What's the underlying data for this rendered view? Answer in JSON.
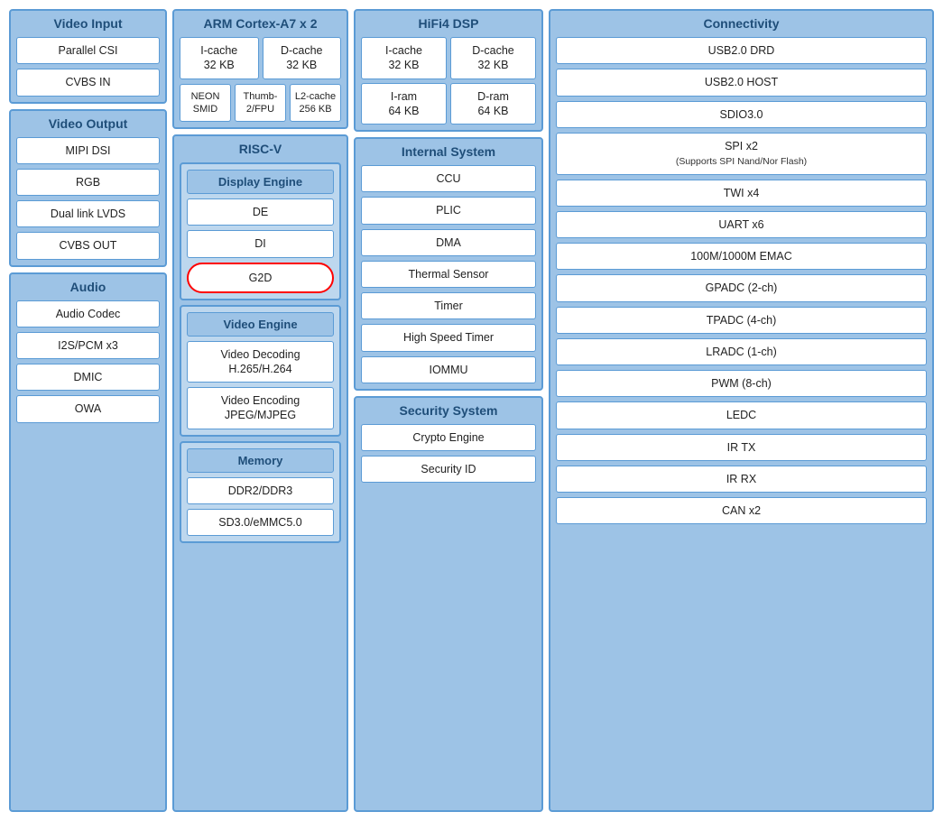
{
  "videoInput": {
    "title": "Video Input",
    "items": [
      "Parallel CSI",
      "CVBS IN"
    ]
  },
  "videoOutput": {
    "title": "Video Output",
    "items": [
      "MIPI DSI",
      "RGB",
      "Dual link LVDS",
      "CVBS OUT"
    ]
  },
  "audio": {
    "title": "Audio",
    "items": [
      "Audio Codec",
      "I2S/PCM x3",
      "DMIC",
      "OWA"
    ]
  },
  "armCortex": {
    "title": "ARM Cortex-A7 x 2",
    "icache": "I-cache\n32 KB",
    "dcache": "D-cache\n32 KB",
    "neon": "NEON\nSMID",
    "thumb": "Thumb-\n2/FPU",
    "l2cache": "L2-cache\n256 KB"
  },
  "riscv": {
    "title": "RISC-V"
  },
  "displayEngine": {
    "title": "Display Engine",
    "items": [
      "DE",
      "DI",
      "G2D"
    ]
  },
  "videoEngine": {
    "title": "Video Engine",
    "items": [
      "Video Decoding\nH.265/H.264",
      "Video Encoding\nJPEG/MJPEG"
    ]
  },
  "memory": {
    "title": "Memory",
    "items": [
      "DDR2/DDR3",
      "SD3.0/eMMC5.0"
    ]
  },
  "hifi4": {
    "title": "HiFi4 DSP",
    "icache": "I-cache\n32 KB",
    "dcache": "D-cache\n32 KB",
    "iram": "I-ram\n64 KB",
    "dram": "D-ram\n64 KB"
  },
  "internalSystem": {
    "title": "Internal System",
    "items": [
      "CCU",
      "PLIC",
      "DMA",
      "Thermal Sensor",
      "Timer",
      "High Speed Timer",
      "IOMMU"
    ]
  },
  "securitySystem": {
    "title": "Security System",
    "items": [
      "Crypto Engine",
      "Security ID"
    ]
  },
  "connectivity": {
    "title": "Connectivity",
    "items": [
      "USB2.0 DRD",
      "USB2.0 HOST",
      "SDIO3.0",
      "SPI x2",
      "(Supports SPI Nand/Nor Flash)",
      "TWI x4",
      "UART x6",
      "100M/1000M EMAC",
      "GPADC (2-ch)",
      "TPADC (4-ch)",
      "LRADC (1-ch)",
      "PWM (8-ch)",
      "LEDC",
      "IR TX",
      "IR RX",
      "CAN x2"
    ]
  }
}
